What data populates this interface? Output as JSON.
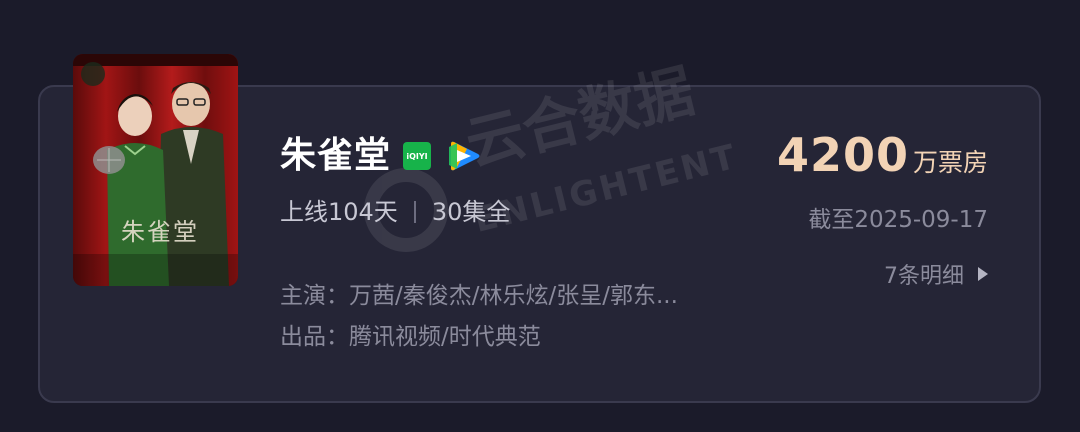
{
  "show": {
    "title": "朱雀堂",
    "poster_title": "朱雀堂",
    "platform_badge": "iQIYI",
    "days_online": "上线104天",
    "episodes": "30集全",
    "cast_label": "主演：",
    "cast": "万茜/秦俊杰/林乐炫/张呈/郭东...",
    "producer_label": "出品：",
    "producers": "腾讯视频/时代典范"
  },
  "box_office": {
    "value": "4200",
    "unit": "万票房",
    "as_of": "截至2025-09-17",
    "details_link": "7条明细"
  },
  "watermark": {
    "text": "云合数据",
    "sub": "ENLIGHTENT"
  },
  "icons": {
    "platform_1": "iqiyi-badge",
    "platform_2": "tencent-video-icon",
    "arrow": "chevron-right-icon"
  },
  "colors": {
    "background": "#1b1b2a",
    "card": "#252536",
    "box_office_accent": "#f2d3b5",
    "iqiyi_green": "#17b34a"
  }
}
